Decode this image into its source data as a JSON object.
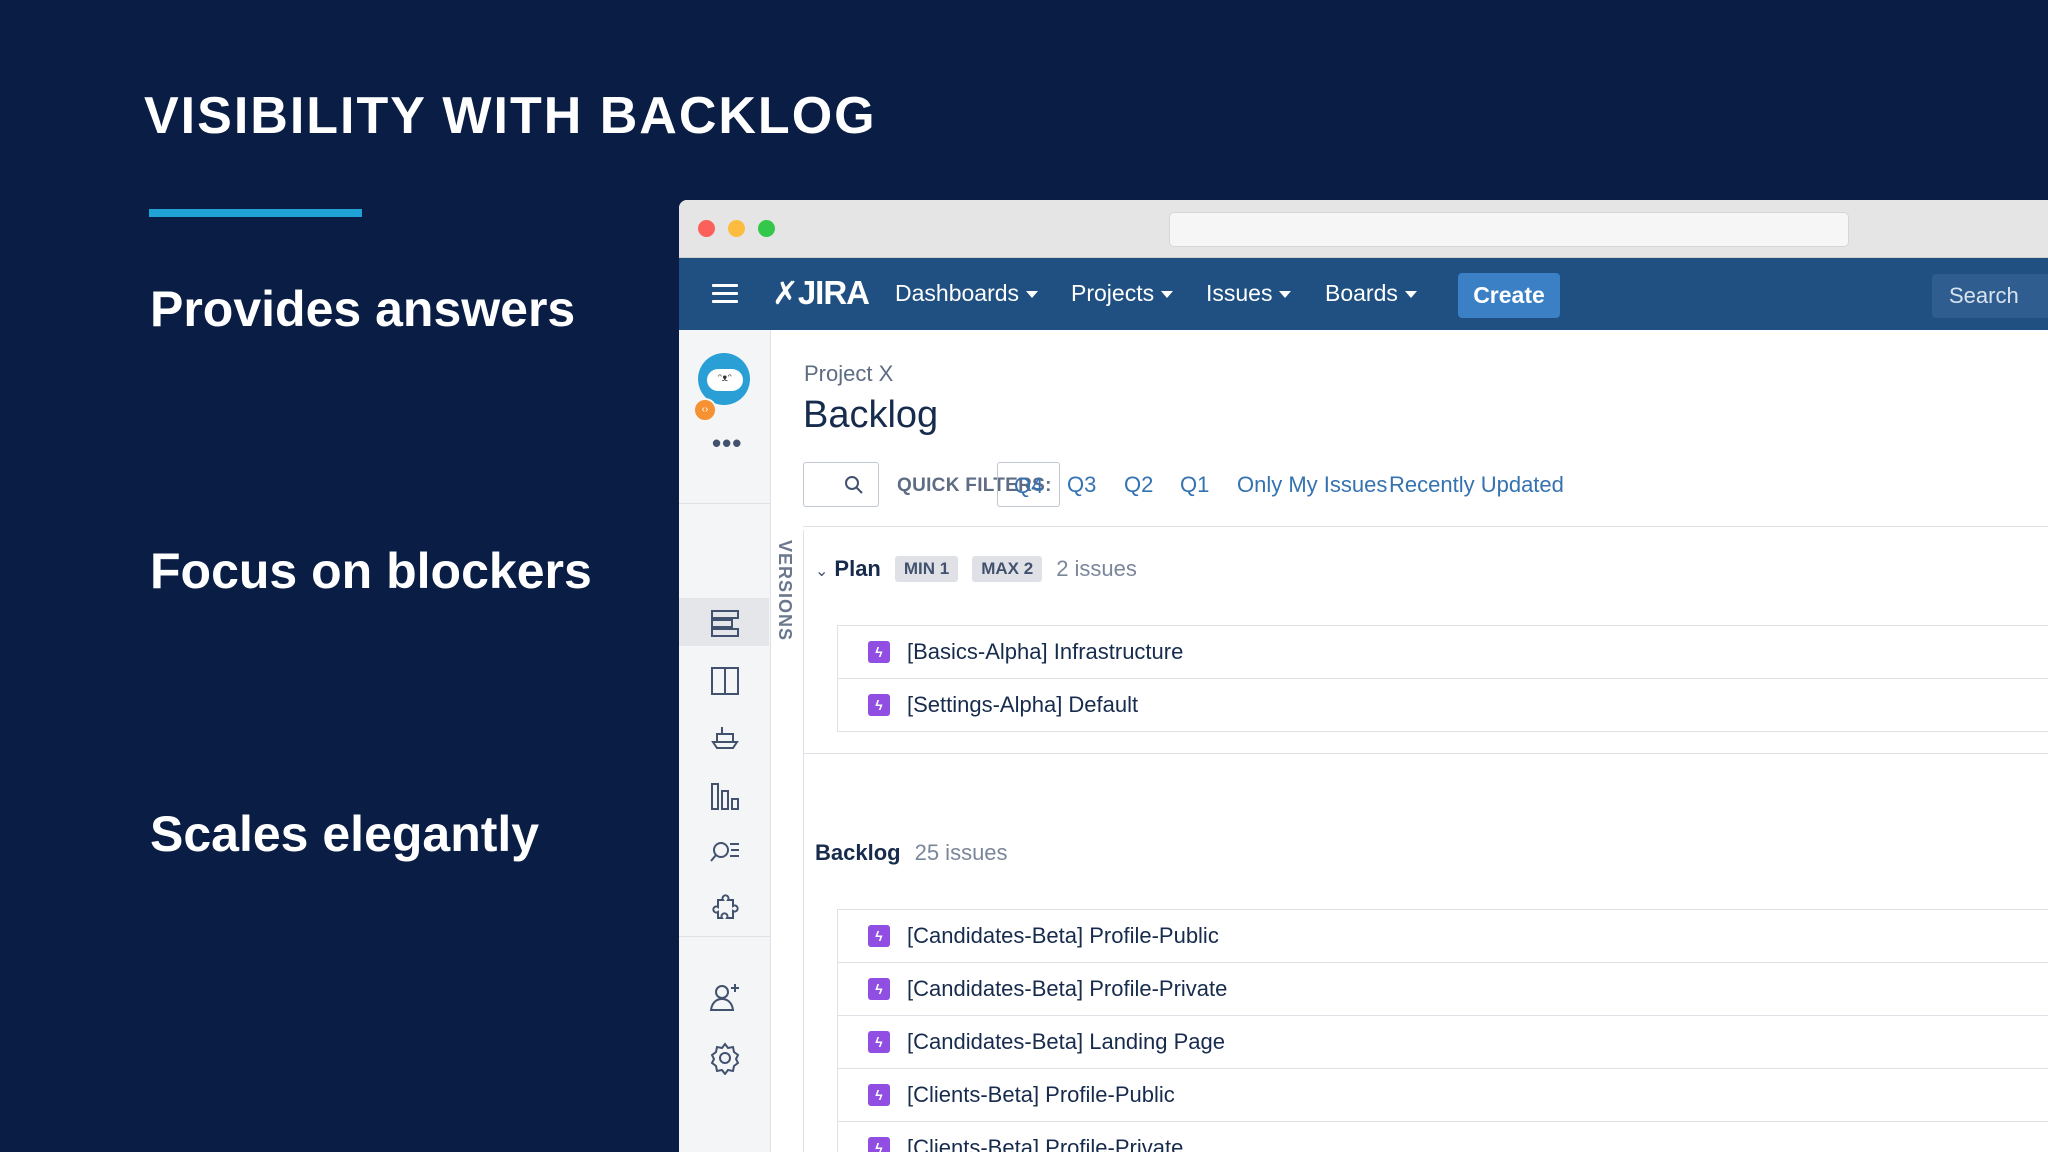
{
  "slide": {
    "title": "VISIBILITY WITH BACKLOG",
    "points": [
      "Provides answers",
      "Focus on blockers",
      "Scales elegantly"
    ]
  },
  "navbar": {
    "logo": "JIRA",
    "items": [
      "Dashboards",
      "Projects",
      "Issues",
      "Boards"
    ],
    "create_label": "Create",
    "search_placeholder": "Search"
  },
  "sidebar": {
    "icons": [
      "backlog-icon",
      "board-icon",
      "releases-icon",
      "reports-icon",
      "issues-search-icon",
      "addons-icon",
      "add-user-icon",
      "settings-icon"
    ],
    "versions_label": "VERSIONS"
  },
  "page": {
    "breadcrumb": "Project X",
    "title": "Backlog"
  },
  "quick_filters": {
    "label": "QUICK FILTERS:",
    "items": [
      "Q4",
      "Q3",
      "Q2",
      "Q1",
      "Only My Issues",
      "Recently Updated"
    ],
    "active": "Q4"
  },
  "sprints": [
    {
      "name": "Plan",
      "min": "MIN 1",
      "max": "MAX 2",
      "count": "2 issues",
      "issues": [
        "[Basics-Alpha] Infrastructure",
        "[Settings-Alpha] Default"
      ]
    }
  ],
  "backlog": {
    "name": "Backlog",
    "count": "25 issues",
    "issues": [
      "[Candidates-Beta] Profile-Public",
      "[Candidates-Beta] Profile-Private",
      "[Candidates-Beta] Landing Page",
      "[Clients-Beta] Profile-Public",
      "[Clients-Beta] Profile-Private"
    ]
  },
  "colors": {
    "slide_bg": "#0a1d44",
    "accent": "#1fa3d6",
    "navbar": "#205081",
    "create": "#3b7fc4",
    "epic_icon": "#904ee2"
  }
}
